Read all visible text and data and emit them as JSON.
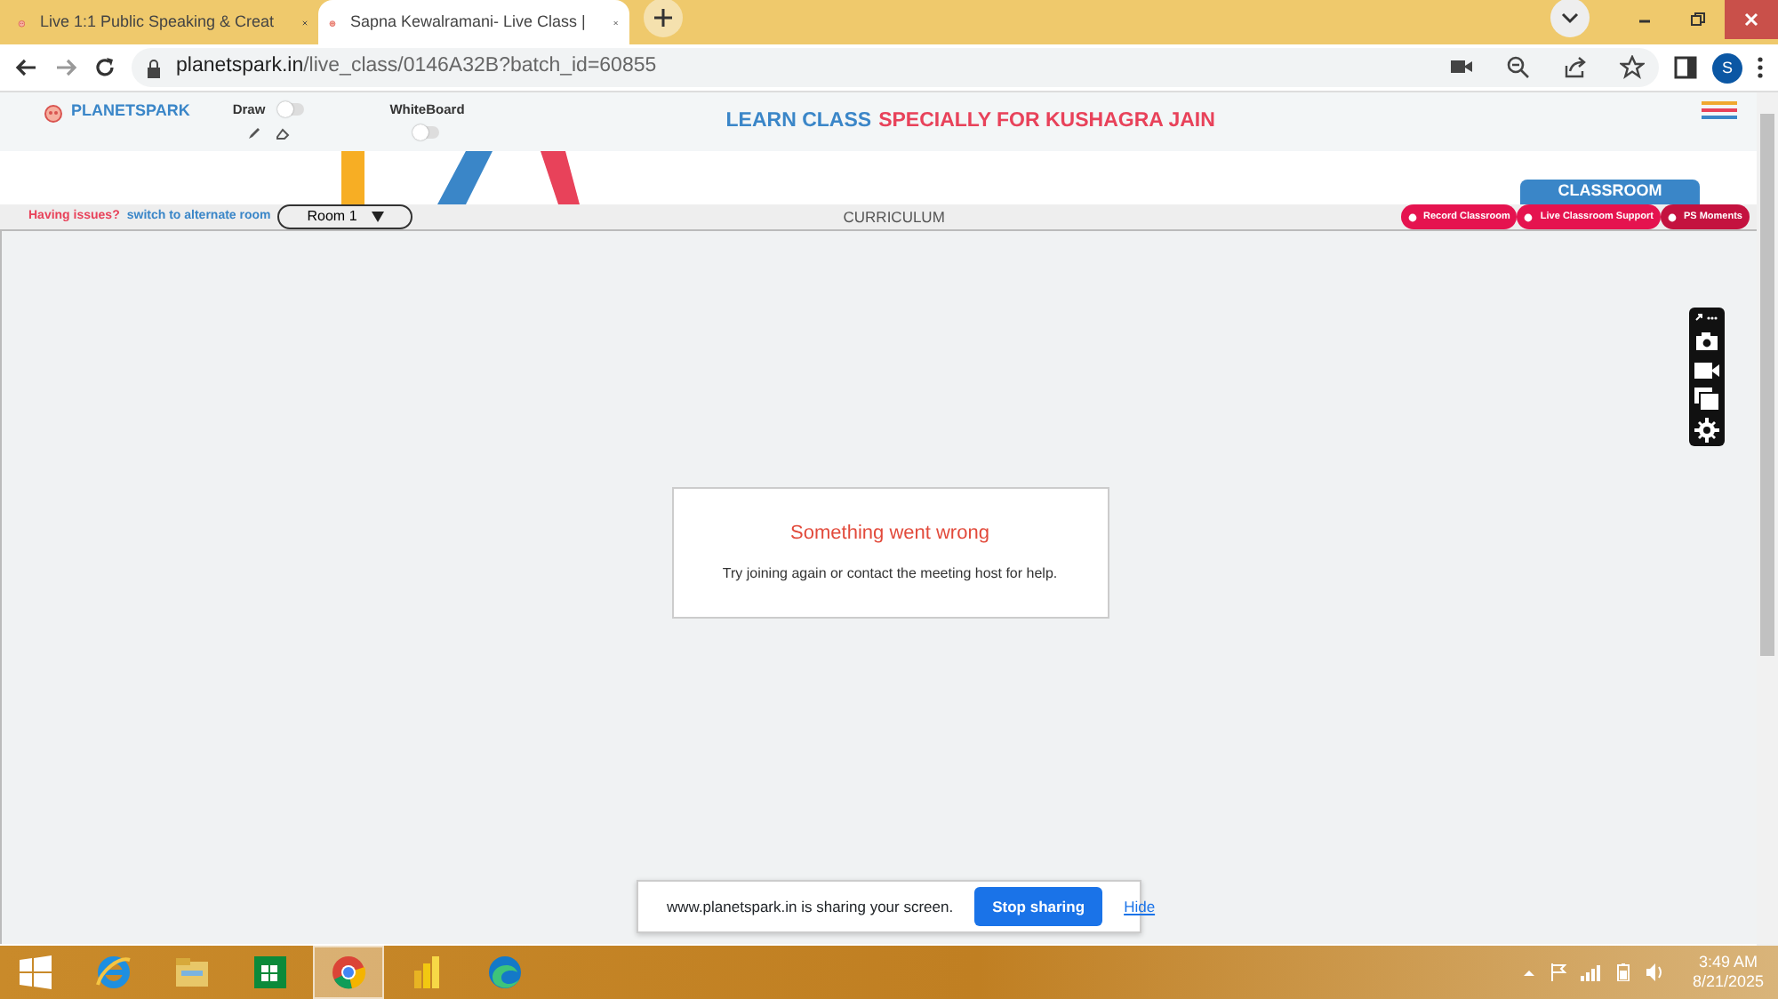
{
  "browser": {
    "tabs": [
      {
        "title": "Live 1:1 Public Speaking & Creat",
        "selected": false
      },
      {
        "title": "Sapna Kewalramani- Live Class |",
        "selected": true
      }
    ],
    "url_host": "planetspark.in",
    "url_path": "/live_class/0146A32B?batch_id=60855",
    "profile_initial": "S"
  },
  "header": {
    "logo": "PLANETSPARK",
    "draw": {
      "label": "Draw",
      "on": false
    },
    "whiteboard": {
      "label": "WhiteBoard",
      "on": false
    },
    "title_parts": [
      {
        "text": "LEARN CLASS",
        "color": "#3a86c8"
      },
      {
        "text": "SPECIALLY FOR KUSHAGRA JAIN",
        "color": "#e8425a"
      }
    ]
  },
  "room_bar": {
    "issues": "Having issues?",
    "switch_link": "switch to alternate room",
    "room": "Room 1",
    "curriculum": "CURRICULUM",
    "classroom_tab": "CLASSROOM",
    "actions": [
      {
        "label": "Record Classroom",
        "color": "#e5134f"
      },
      {
        "label": "Live Classroom Support",
        "color": "#e5134f"
      },
      {
        "label": "PS Moments",
        "color": "#c4123f"
      }
    ]
  },
  "error": {
    "title": "Something went wrong",
    "message": "Try joining again or contact the meeting host for help."
  },
  "share_bar": {
    "message": "www.planetspark.in is sharing your screen.",
    "stop": "Stop sharing",
    "hide": "Hide"
  },
  "taskbar": {
    "apps": [
      {
        "kind": "ie",
        "active": false
      },
      {
        "kind": "explorer",
        "active": false
      },
      {
        "kind": "store",
        "active": false
      },
      {
        "kind": "chrome",
        "active": true
      },
      {
        "kind": "powerbi",
        "active": false
      },
      {
        "kind": "edge",
        "active": false
      }
    ],
    "time": "3:49 AM",
    "date": "8/21/2025"
  }
}
